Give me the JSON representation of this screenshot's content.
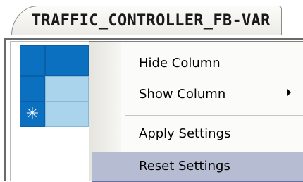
{
  "tab": {
    "title": "TRAFFIC_CONTROLLER_FB-VAR"
  },
  "grid": {
    "new_row_marker": "✳"
  },
  "context_menu": {
    "items": [
      {
        "label": "Hide Column",
        "submenu": false,
        "highlighted": false
      },
      {
        "label": "Show Column",
        "submenu": true,
        "highlighted": false
      },
      {
        "label": "Apply Settings",
        "submenu": false,
        "highlighted": false
      },
      {
        "label": "Reset Settings",
        "submenu": false,
        "highlighted": true
      }
    ]
  },
  "colors": {
    "header_blue": "#0b70c0",
    "cell_light_blue": "#a9d4ec",
    "menu_highlight": "#b6bdd2",
    "menu_highlight_border": "#6272a6"
  }
}
